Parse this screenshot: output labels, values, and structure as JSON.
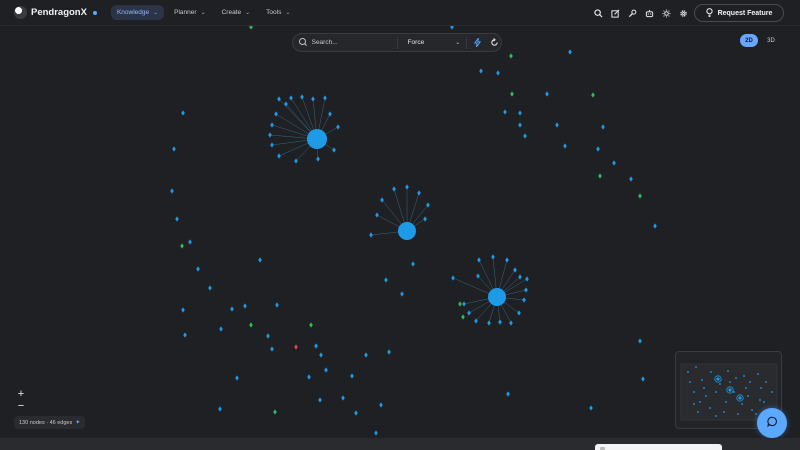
{
  "brand": {
    "name": "PendragonX"
  },
  "nav": [
    {
      "label": "Knowledge",
      "active": true
    },
    {
      "label": "Planner",
      "active": false
    },
    {
      "label": "Create",
      "active": false
    },
    {
      "label": "Tools",
      "active": false
    }
  ],
  "top_icons": [
    "search-icon",
    "external-link-icon",
    "wrench-icon",
    "robot-icon",
    "sun-icon",
    "gear-icon"
  ],
  "request_feature": {
    "label": "Request Feature",
    "icon": "lightbulb-icon"
  },
  "search": {
    "placeholder": "Search...",
    "value": ""
  },
  "layout_select": {
    "value": "Force"
  },
  "view_toggle": {
    "options": [
      "2D",
      "3D"
    ],
    "selected": "2D"
  },
  "graph": {
    "colors": {
      "node": "#1e9be8",
      "node_green": "#2fbf55",
      "node_red": "#e0454a",
      "edge": "#4a9fd0",
      "background": "#1f2023"
    },
    "hub_labels": [
      "",
      "",
      ""
    ]
  },
  "zoom": {
    "in_label": "+",
    "out_label": "−"
  },
  "stats": {
    "text": "130 nodes · 46 edges"
  },
  "minimap": {
    "visible": true
  },
  "chat": {
    "icon": "chat-bubble-icon"
  }
}
